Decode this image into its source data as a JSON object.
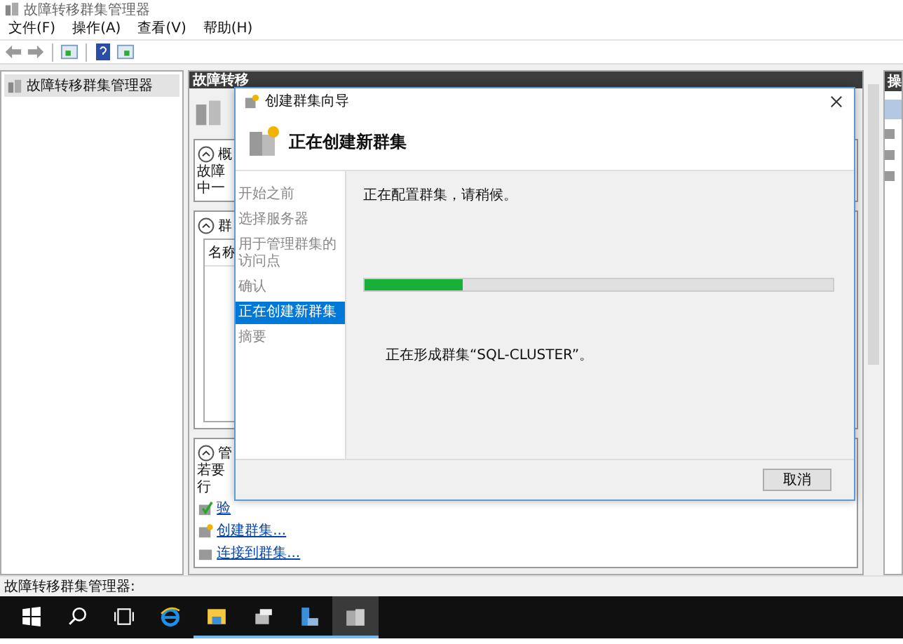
{
  "window": {
    "title": "故障转移群集管理器"
  },
  "menu": [
    {
      "label": "文件(F)"
    },
    {
      "label": "操作(A)"
    },
    {
      "label": "查看(V)"
    },
    {
      "label": "帮助(H)"
    }
  ],
  "tree": [
    {
      "label": "故障转移群集管理器",
      "selected": true
    }
  ],
  "middle": {
    "header": "故障转移",
    "sections": [
      {
        "kind": "text",
        "title": "概",
        "lines": [
          "故障",
          "中一"
        ]
      },
      {
        "kind": "table",
        "title": "群",
        "column": "名称"
      },
      {
        "kind": "links",
        "title": "管",
        "lines": [
          "若要",
          "行"
        ],
        "links": [
          {
            "label": "验",
            "kind": "validate"
          },
          {
            "label": "创建群集...",
            "kind": "create"
          },
          {
            "label": "连接到群集...",
            "kind": "connect"
          }
        ]
      }
    ]
  },
  "actions": {
    "header": "操"
  },
  "status_bar": "故障转移群集管理器:",
  "taskbar": [
    {
      "kind": "start",
      "running": false,
      "selected": false
    },
    {
      "kind": "search",
      "running": false,
      "selected": false
    },
    {
      "kind": "taskview",
      "running": false,
      "selected": false
    },
    {
      "kind": "browser",
      "running": false,
      "selected": false
    },
    {
      "kind": "folder",
      "running": true,
      "selected": false
    },
    {
      "kind": "server",
      "running": true,
      "selected": false
    },
    {
      "kind": "computer",
      "running": true,
      "selected": false
    },
    {
      "kind": "cluster",
      "running": true,
      "selected": true
    }
  ],
  "dialog": {
    "title": "创建群集向导",
    "heading": "正在创建新群集",
    "steps": [
      {
        "label": "开始之前",
        "selected": false
      },
      {
        "label": "选择服务器",
        "selected": false
      },
      {
        "label": "用于管理群集的访问点",
        "selected": false
      },
      {
        "label": "确认",
        "selected": false
      },
      {
        "label": "正在创建新群集",
        "selected": true
      },
      {
        "label": "摘要",
        "selected": false
      }
    ],
    "message": "正在配置群集，请稍候。",
    "progress": {
      "level": 0.21
    },
    "status": "正在形成群集“SQL-CLUSTER”。",
    "buttons": [
      "取消"
    ]
  }
}
